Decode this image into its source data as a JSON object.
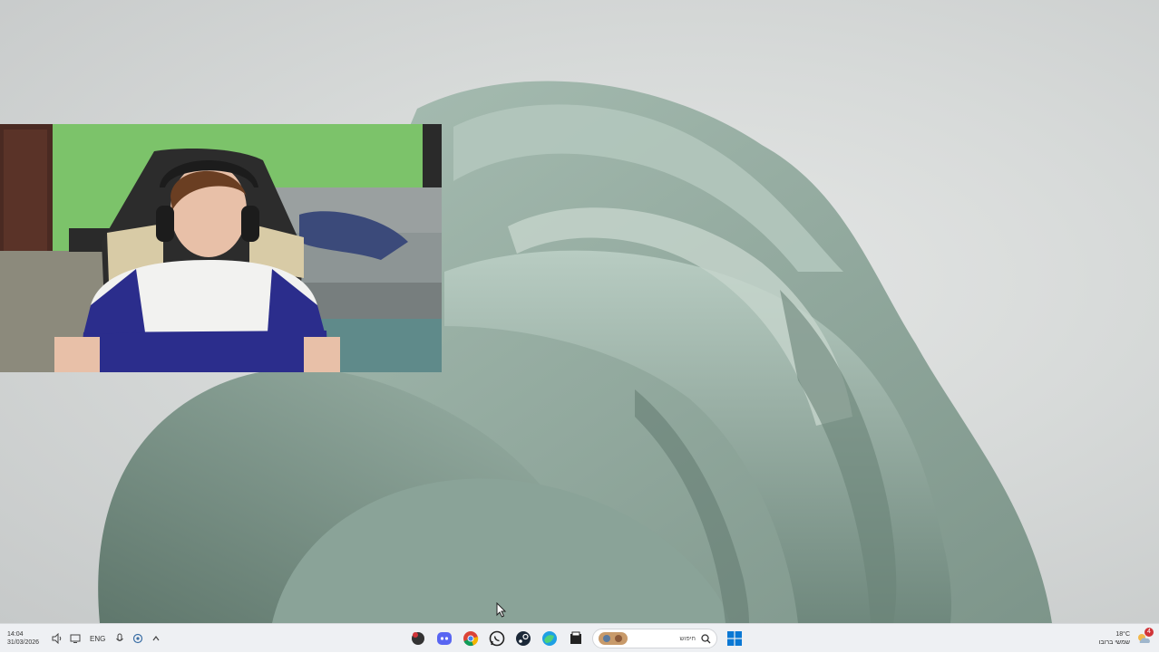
{
  "taskbar": {
    "clock": {
      "time": "14:04",
      "date": "31/03/2026"
    },
    "language": "ENG",
    "search": {
      "text": "חיפוש"
    },
    "weather": {
      "temp": "18°C",
      "status": "שמשי ברובו"
    },
    "notification_count": "4",
    "pinned_apps": [
      {
        "name": "dino-app-icon"
      },
      {
        "name": "discord-icon"
      },
      {
        "name": "chrome-icon"
      },
      {
        "name": "whatsapp-icon"
      },
      {
        "name": "steam-icon"
      },
      {
        "name": "edge-icon"
      },
      {
        "name": "file-explorer-icon"
      }
    ]
  },
  "colors": {
    "wallpaper_bloom": "#8fa79c",
    "wallpaper_bg": "#d7dad9",
    "taskbar_bg": "#eef0f3",
    "webcam_wall": "#7cc36a"
  },
  "overlay": {
    "type": "webcam-feed"
  }
}
